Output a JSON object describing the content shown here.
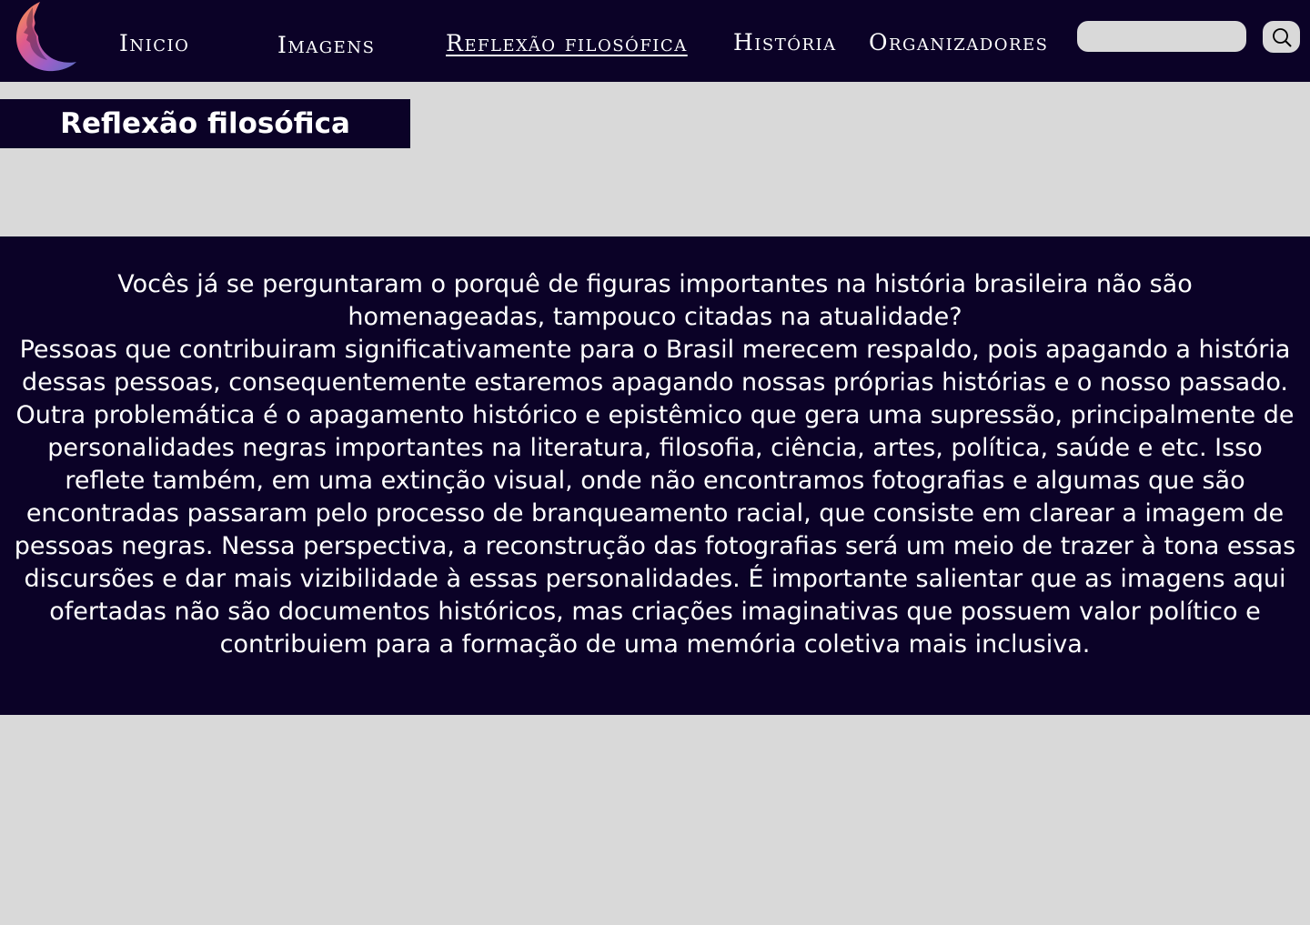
{
  "header": {
    "logo_icon": "woman-profile-crescent-logo",
    "nav": {
      "inicio": "Inicio",
      "imagens": "Imagens",
      "reflexao": "Reflexão filosófica",
      "historia": "História",
      "organizadores": "Organizadores"
    },
    "active_item": "Reflexão filosófica",
    "search": {
      "placeholder": "",
      "value": "",
      "button_icon": "search-icon"
    }
  },
  "page": {
    "title": "Reflexão filosófica",
    "question": "Vocês já se perguntaram o porquê de figuras importantes na história brasileira não são homenageadas, tampouco citadas na atualidade?",
    "body": "Pessoas que contribuiram significativamente para o Brasil merecem respaldo, pois apagando a história dessas pessoas, consequentemente estaremos apagando nossas próprias histórias e o nosso passado. Outra problemática é o apagamento histórico e epistêmico que gera uma supressão, principalmente de personalidades negras importantes na literatura, filosofia, ciência, artes, política, saúde e etc. Isso reflete também, em uma extinção visual, onde não encontramos fotografias e algumas que são encontradas passaram pelo processo de branqueamento racial, que consiste em clarear a imagem de pessoas negras.  Nessa perspectiva, a reconstrução das fotografias será um meio de trazer à tona essas discursões e dar mais vizibilidade à essas personalidades. É importante salientar que as imagens aqui ofertadas não são documentos históricos, mas criações imaginativas que possuem valor político e contribuiem para a formação de uma memória coletiva mais inclusiva."
  },
  "colors": {
    "navy": "#0b0227",
    "background": "#d9d9d9",
    "text": "#ffffff",
    "logo_gradient": [
      "#f7a14a",
      "#e05a8c",
      "#9a5fc8",
      "#5b6fc4"
    ]
  }
}
